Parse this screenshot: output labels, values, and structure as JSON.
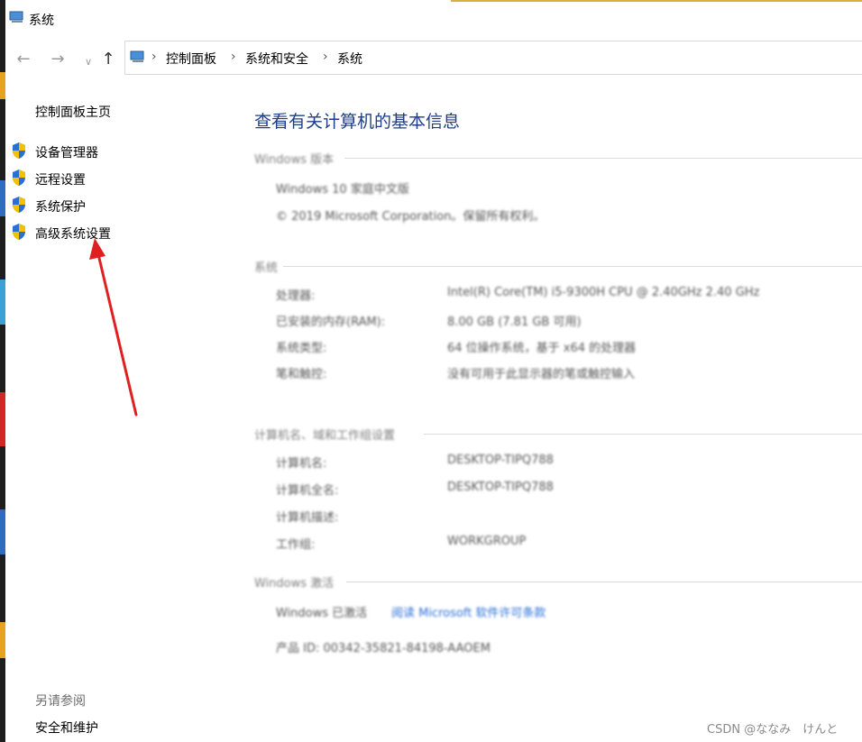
{
  "window": {
    "title": "系统"
  },
  "nav": {
    "back_icon": "arrow-left-icon",
    "forward_icon": "arrow-right-icon",
    "recent_icon": "chevron-down-icon",
    "up_icon": "arrow-up-icon",
    "breadcrumbs": [
      "控制面板",
      "系统和安全",
      "系统"
    ],
    "separator": "›"
  },
  "sidebar": {
    "home": "控制面板主页",
    "items": [
      {
        "label": "设备管理器",
        "icon": "shield-icon"
      },
      {
        "label": "远程设置",
        "icon": "shield-icon"
      },
      {
        "label": "系统保护",
        "icon": "shield-icon"
      },
      {
        "label": "高级系统设置",
        "icon": "shield-icon"
      }
    ],
    "see_also_heading": "另请参阅",
    "see_also_items": [
      "安全和维护"
    ]
  },
  "main": {
    "title": "查看有关计算机的基本信息",
    "edition": {
      "heading": "Windows 版本",
      "name": "Windows 10 家庭中文版",
      "copyright": "© 2019 Microsoft Corporation。保留所有权利。"
    },
    "system": {
      "heading": "系统",
      "rows": [
        {
          "label": "处理器:",
          "value": "Intel(R) Core(TM) i5-9300H CPU @ 2.40GHz   2.40 GHz"
        },
        {
          "label": "已安装的内存(RAM):",
          "value": "8.00 GB (7.81 GB 可用)"
        },
        {
          "label": "系统类型:",
          "value": "64 位操作系统，基于 x64 的处理器"
        },
        {
          "label": "笔和触控:",
          "value": "没有可用于此显示器的笔或触控输入"
        }
      ]
    },
    "computer": {
      "heading": "计算机名、域和工作组设置",
      "rows": [
        {
          "label": "计算机名:",
          "value": "DESKTOP-TIPQ788"
        },
        {
          "label": "计算机全名:",
          "value": "DESKTOP-TIPQ788"
        },
        {
          "label": "计算机描述:",
          "value": ""
        },
        {
          "label": "工作组:",
          "value": "WORKGROUP"
        }
      ]
    },
    "activation": {
      "heading": "Windows 激活",
      "status": "Windows 已激活",
      "link": "阅读 Microsoft 软件许可条款",
      "product_id": "产品 ID: 00342-35821-84198-AAOEM"
    }
  },
  "watermark": "CSDN @ななみ　けんと",
  "colors": {
    "title_blue": "#1e3d87",
    "link_blue": "#2a6fd6",
    "annotation_red": "#e02020"
  }
}
